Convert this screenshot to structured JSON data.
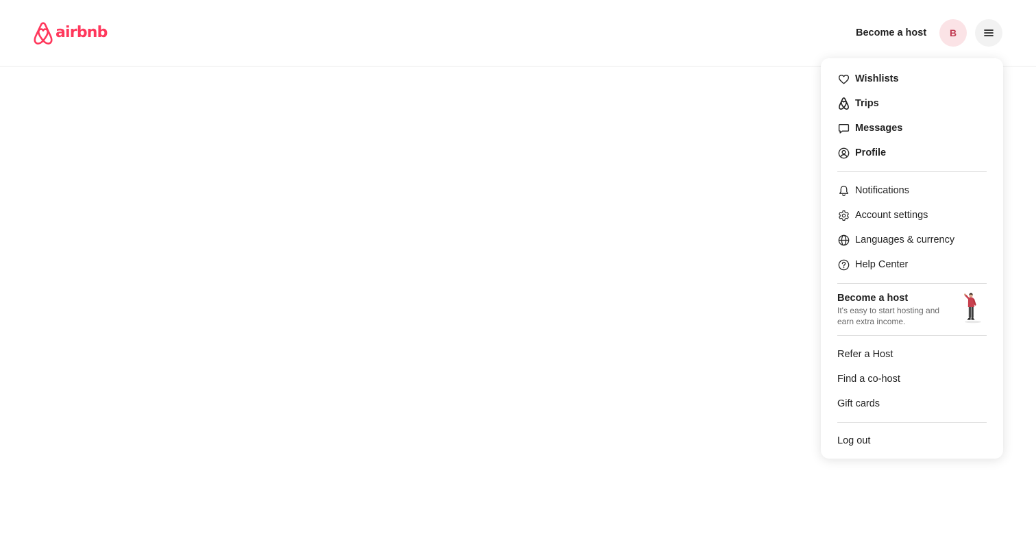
{
  "brand": {
    "name": "airbnb",
    "color": "#ff385c",
    "icon": "airbnb-logo-icon"
  },
  "header": {
    "become_host": "Become a host",
    "avatar_initial": "B",
    "menu_icon": "hamburger-icon"
  },
  "menu": {
    "primary": [
      {
        "label": "Wishlists",
        "icon": "heart-icon"
      },
      {
        "label": "Trips",
        "icon": "airbnb-logo-icon"
      },
      {
        "label": "Messages",
        "icon": "message-icon"
      },
      {
        "label": "Profile",
        "icon": "user-circle-icon"
      }
    ],
    "secondary": [
      {
        "label": "Notifications",
        "icon": "bell-icon"
      },
      {
        "label": "Account settings",
        "icon": "gear-icon"
      },
      {
        "label": "Languages & currency",
        "icon": "globe-icon"
      },
      {
        "label": "Help Center",
        "icon": "question-circle-icon"
      }
    ],
    "host_promo": {
      "title": "Become a host",
      "subtitle": "It's easy to start hosting and earn extra income."
    },
    "host_links": [
      "Refer a Host",
      "Find a co-host",
      "Gift cards"
    ],
    "logout": "Log out"
  }
}
